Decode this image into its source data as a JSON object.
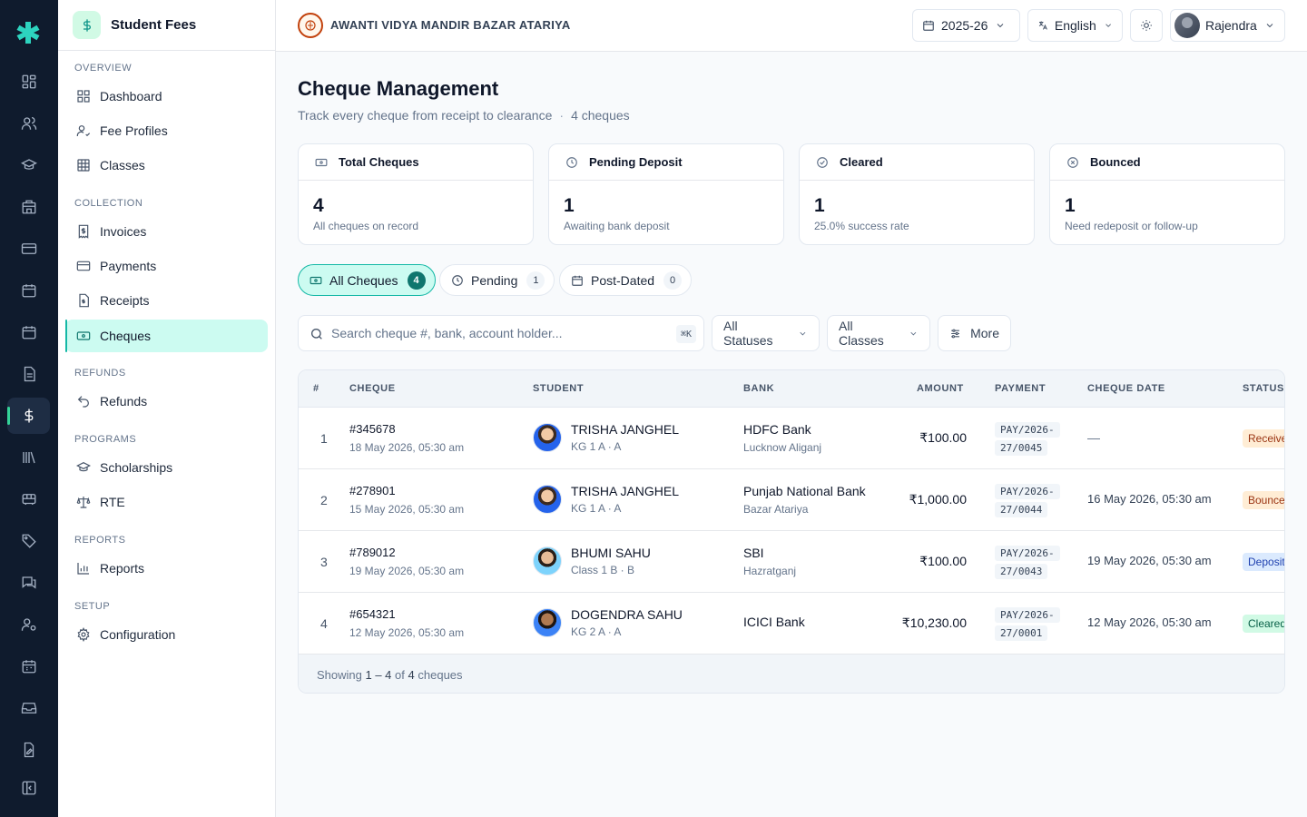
{
  "module": {
    "title": "Student Fees"
  },
  "sidebar": {
    "sections": [
      {
        "label": "Overview",
        "items": [
          {
            "label": "Dashboard"
          },
          {
            "label": "Fee Profiles"
          },
          {
            "label": "Classes"
          }
        ]
      },
      {
        "label": "Collection",
        "items": [
          {
            "label": "Invoices"
          },
          {
            "label": "Payments"
          },
          {
            "label": "Receipts"
          },
          {
            "label": "Cheques",
            "active": true
          }
        ]
      },
      {
        "label": "Refunds",
        "items": [
          {
            "label": "Refunds"
          }
        ]
      },
      {
        "label": "Programs",
        "items": [
          {
            "label": "Scholarships"
          },
          {
            "label": "RTE"
          }
        ]
      },
      {
        "label": "Reports",
        "items": [
          {
            "label": "Reports"
          }
        ]
      },
      {
        "label": "Setup",
        "items": [
          {
            "label": "Configuration"
          }
        ]
      }
    ]
  },
  "topbar": {
    "school_name": "AWANTI VIDYA MANDIR BAZAR ATARIYA",
    "session": "2025-26",
    "language": "English",
    "user": "Rajendra"
  },
  "page": {
    "title": "Cheque Management",
    "subtitle": "Track every cheque from receipt to clearance",
    "count_text": "4 cheques"
  },
  "stats": [
    {
      "title": "Total Cheques",
      "value": "4",
      "desc": "All cheques on record",
      "icon": "cheque-icon"
    },
    {
      "title": "Pending Deposit",
      "value": "1",
      "desc": "Awaiting bank deposit",
      "icon": "clock-icon"
    },
    {
      "title": "Cleared",
      "value": "1",
      "desc": "25.0% success rate",
      "icon": "check-circle-icon"
    },
    {
      "title": "Bounced",
      "value": "1",
      "desc": "Need redeposit or follow-up",
      "icon": "x-circle-icon"
    }
  ],
  "tabs": [
    {
      "label": "All Cheques",
      "count": "4",
      "active": true
    },
    {
      "label": "Pending",
      "count": "1"
    },
    {
      "label": "Post-Dated",
      "count": "0"
    }
  ],
  "filters": {
    "search_placeholder": "Search cheque #, bank, account holder...",
    "shortcut": "⌘K",
    "status": "All Statuses",
    "classes": "All Classes",
    "more": "More"
  },
  "table": {
    "columns": [
      "#",
      "Cheque",
      "Student",
      "Bank",
      "Amount",
      "Payment",
      "Cheque Date",
      "Status"
    ],
    "rows": [
      {
        "idx": "1",
        "cheque_no": "#345678",
        "received": "18 May 2026, 05:30 am",
        "student": "TRISHA JANGHEL",
        "class": "KG 1 A · A",
        "bank": "HDFC Bank",
        "branch": "Lucknow Aliganj",
        "amount": "₹100.00",
        "pay1": "PAY/2026-",
        "pay2": "27/0045",
        "cheque_date": "—",
        "status": "Received",
        "status_bg": "#ffedd5",
        "status_fg": "#9a3412"
      },
      {
        "idx": "2",
        "cheque_no": "#278901",
        "received": "15 May 2026, 05:30 am",
        "student": "TRISHA JANGHEL",
        "class": "KG 1 A · A",
        "bank": "Punjab National Bank",
        "branch": "Bazar Atariya",
        "amount": "₹1,000.00",
        "pay1": "PAY/2026-",
        "pay2": "27/0044",
        "cheque_date": "16 May 2026, 05:30 am",
        "status": "Bounced",
        "status_bg": "#ffedd5",
        "status_fg": "#9a3412"
      },
      {
        "idx": "3",
        "cheque_no": "#789012",
        "received": "19 May 2026, 05:30 am",
        "student": "BHUMI SAHU",
        "class": "Class 1 B · B",
        "bank": "SBI",
        "branch": "Hazratganj",
        "amount": "₹100.00",
        "pay1": "PAY/2026-",
        "pay2": "27/0043",
        "cheque_date": "19 May 2026, 05:30 am",
        "status": "Deposited",
        "status_bg": "#dbeafe",
        "status_fg": "#1e40af"
      },
      {
        "idx": "4",
        "cheque_no": "#654321",
        "received": "12 May 2026, 05:30 am",
        "student": "DOGENDRA SAHU",
        "class": "KG 2 A · A",
        "bank": "ICICI Bank",
        "branch": "",
        "amount": "₹10,230.00",
        "pay1": "PAY/2026-",
        "pay2": "27/0001",
        "cheque_date": "12 May 2026, 05:30 am",
        "status": "Cleared",
        "status_bg": "#d1fae5",
        "status_fg": "#065f46"
      }
    ],
    "footer": {
      "prefix": "Showing",
      "range": "1 – 4",
      "of": "of",
      "total": "4",
      "suffix": "cheques"
    }
  },
  "colors": {
    "accent": "#14b8a6",
    "accent_light": "#ccfbf1",
    "rail": "#0f1b2d"
  }
}
